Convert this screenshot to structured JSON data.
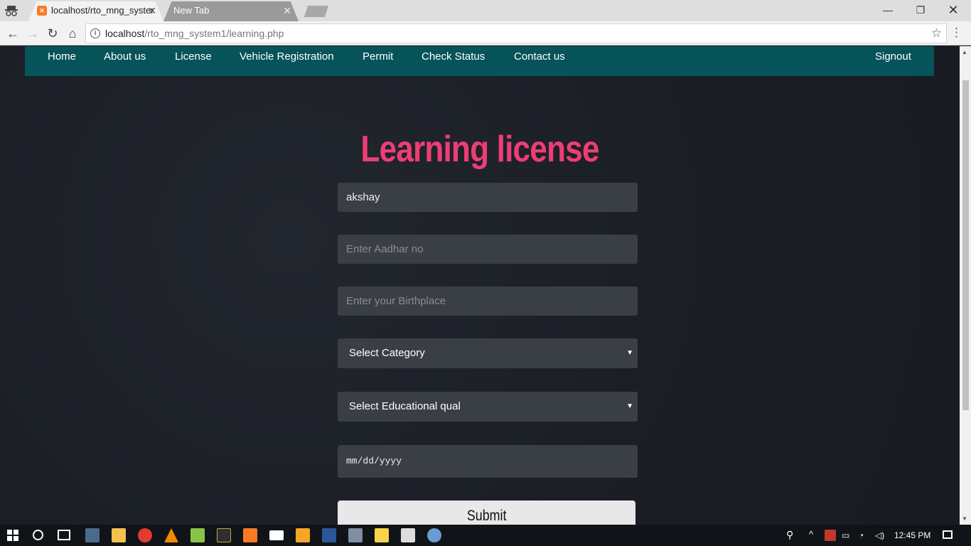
{
  "browser": {
    "tabs": [
      {
        "title": "localhost/rto_mng_syster",
        "active": true
      },
      {
        "title": "New Tab",
        "active": false
      }
    ],
    "url_host": "localhost",
    "url_path": "/rto_mng_system1/learning.php"
  },
  "nav": {
    "items": [
      "Home",
      "About us",
      "License",
      "Vehicle Registration",
      "Permit",
      "Check Status",
      "Contact us"
    ],
    "signout": "Signout"
  },
  "form": {
    "title": "Learning license",
    "name_value": "akshay",
    "aadhar_placeholder": "Enter Aadhar no",
    "birthplace_placeholder": "Enter your Birthplace",
    "category_selected": "Select Category",
    "education_selected": "Select Educational qual",
    "date_placeholder": "mm/dd/yyyy",
    "submit_label": "Submit"
  },
  "taskbar": {
    "clock": "12:45 PM"
  },
  "colors": {
    "nav_bg": "#06535a",
    "title": "#ee3d75",
    "field_bg": "#3a3e45"
  }
}
